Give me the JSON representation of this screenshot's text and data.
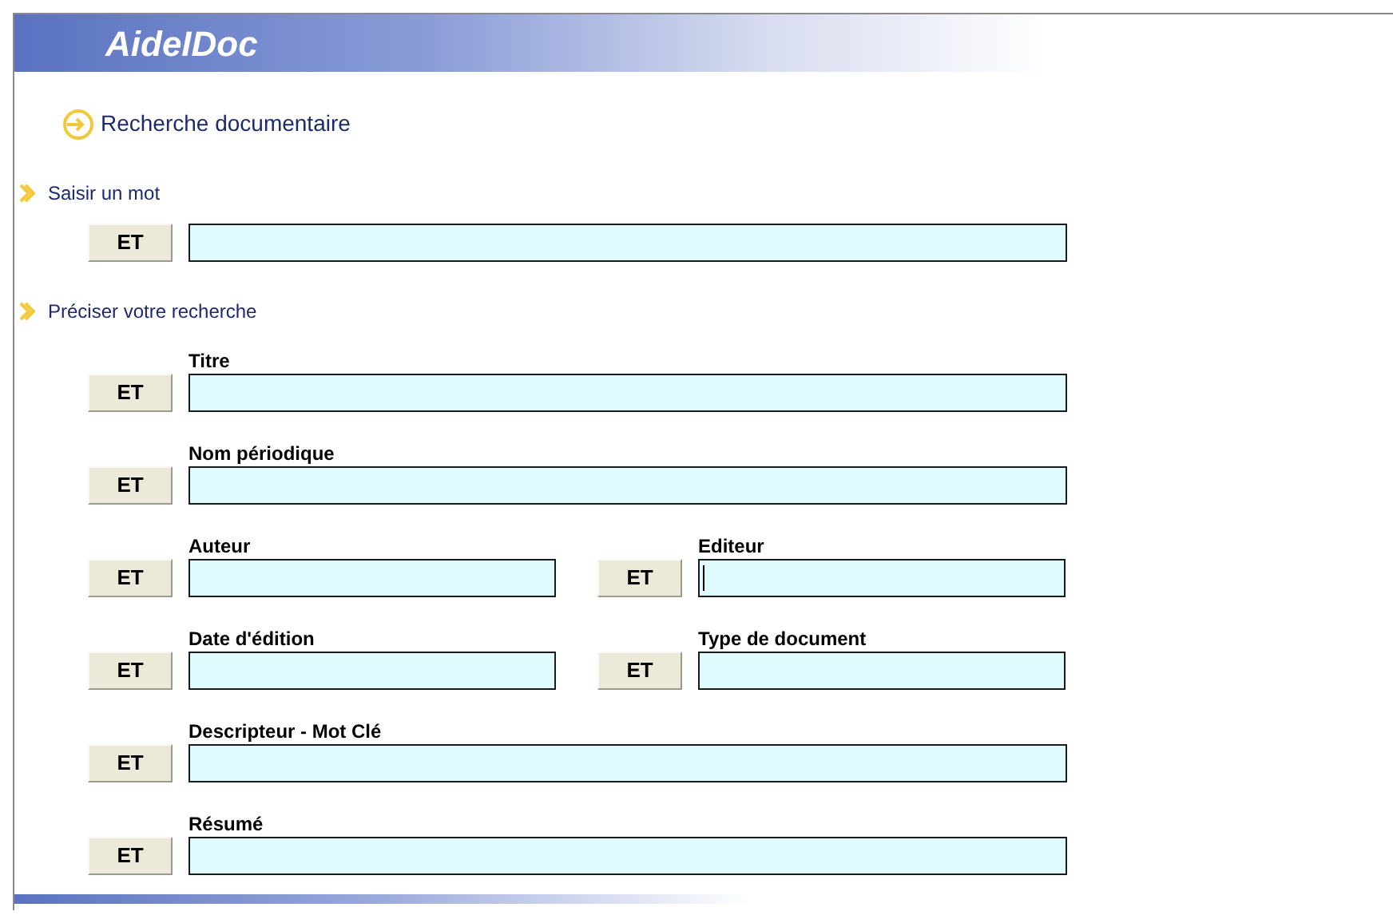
{
  "app": {
    "logo": "AideIDoc"
  },
  "heading": "Recherche documentaire",
  "sections": [
    {
      "title": "Saisir un mot",
      "rows": [
        {
          "fields": [
            {
              "button": "ET",
              "focused": false
            }
          ]
        }
      ]
    },
    {
      "title": "Préciser votre recherche",
      "rows": [
        {
          "fields": [
            {
              "label": "Titre",
              "button": "ET",
              "focused": false
            }
          ]
        },
        {
          "fields": [
            {
              "label": "Nom périodique",
              "button": "ET",
              "focused": false
            }
          ]
        },
        {
          "fields": [
            {
              "label": "Auteur",
              "button": "ET",
              "focused": false
            },
            {
              "label": "Editeur",
              "button": "ET",
              "focused": true
            }
          ]
        },
        {
          "fields": [
            {
              "label": "Date d'édition",
              "button": "ET",
              "focused": false
            },
            {
              "label": "Type de document",
              "button": "ET",
              "focused": false
            }
          ]
        },
        {
          "fields": [
            {
              "label": "Descripteur - Mot Clé",
              "button": "ET",
              "focused": false
            }
          ]
        },
        {
          "fields": [
            {
              "label": "Résumé",
              "button": "ET",
              "focused": false
            }
          ]
        }
      ]
    }
  ]
}
